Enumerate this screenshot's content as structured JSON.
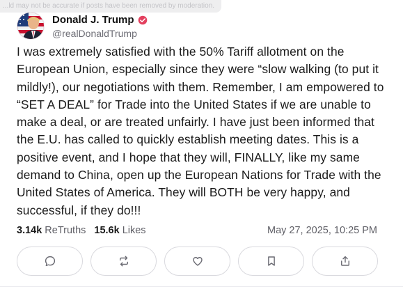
{
  "banner": {
    "text": "...ld may not be accurate if posts have been removed by moderation."
  },
  "post": {
    "author": {
      "display_name": "Donald J. Trump",
      "handle": "@realDonaldTrump",
      "verified": true,
      "avatar": "profile-photo-flag-background"
    },
    "text": "I was extremely satisfied with the 50% Tariff allotment on the European Union, especially since they were “slow walking (to put it mildly!), our negotiations with them. Remember, I am empowered to “SET A DEAL” for Trade into the United States if we are unable to make a deal, or are treated unfairly. I have just been informed that the E.U. has called to quickly establish meeting dates. This is a positive event, and I hope that they will, FINALLY, like my same demand to China, open up the European Nations for Trade with the United States of America. They will BOTH be very happy, and successful, if they do!!!",
    "stats": {
      "retruths_count": "3.14k",
      "retruths_label": "ReTruths",
      "likes_count": "15.6k",
      "likes_label": "Likes"
    },
    "timestamp": "May 27, 2025, 10:25 PM"
  },
  "actions": [
    {
      "name": "reply",
      "icon": "comment-icon"
    },
    {
      "name": "retruth",
      "icon": "repost-icon"
    },
    {
      "name": "like",
      "icon": "heart-icon"
    },
    {
      "name": "save",
      "icon": "bookmark-icon"
    },
    {
      "name": "share",
      "icon": "share-icon"
    }
  ],
  "colors": {
    "verified_badge": "#e3405f",
    "icon": "#6b6b73",
    "border": "#d9d9de"
  }
}
